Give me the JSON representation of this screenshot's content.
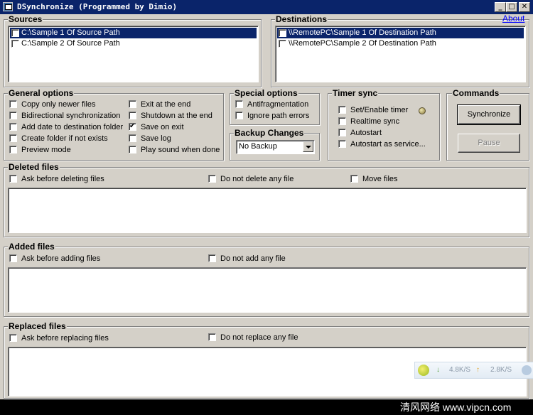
{
  "window": {
    "title": "DSynchronize (Programmed by Dimio)",
    "min": "_",
    "max": "□",
    "close": "✕"
  },
  "sources": {
    "title": "Sources",
    "items": [
      {
        "path": "C:\\Sample 1 Of Source Path",
        "selected": true
      },
      {
        "path": "C:\\Sample 2 Of Source Path",
        "selected": false
      }
    ]
  },
  "destinations": {
    "title": "Destinations",
    "about": "About",
    "items": [
      {
        "path": "\\\\RemotePC\\Sample 1 Of Destination Path",
        "selected": true
      },
      {
        "path": "\\\\RemotePC\\Sample 2 Of Destination Path",
        "selected": false
      }
    ]
  },
  "general_options": {
    "title": "General options",
    "col1": [
      {
        "label": "Copy only newer files",
        "checked": false
      },
      {
        "label": "Bidirectional synchronization",
        "checked": false
      },
      {
        "label": "Add date to destination folder",
        "checked": false
      },
      {
        "label": "Create folder if not exists",
        "checked": false
      },
      {
        "label": "Preview mode",
        "checked": false
      }
    ],
    "col2": [
      {
        "label": "Exit at the end",
        "checked": false
      },
      {
        "label": "Shutdown at the end",
        "checked": false
      },
      {
        "label": "Save on exit",
        "checked": true
      },
      {
        "label": "Save log",
        "checked": false
      },
      {
        "label": "Play sound when done",
        "checked": false
      }
    ]
  },
  "special_options": {
    "title": "Special options",
    "items": [
      {
        "label": "Antifragmentation",
        "checked": false
      },
      {
        "label": "Ignore path errors",
        "checked": false
      }
    ]
  },
  "backup_changes": {
    "title": "Backup Changes",
    "selected": "No Backup"
  },
  "timer_sync": {
    "title": "Timer sync",
    "items": [
      {
        "label": "Set/Enable timer",
        "checked": false
      },
      {
        "label": "Realtime sync",
        "checked": false
      },
      {
        "label": "Autostart",
        "checked": false
      },
      {
        "label": "Autostart as service...",
        "checked": false
      }
    ]
  },
  "commands": {
    "title": "Commands",
    "synchronize": "Synchronize",
    "pause": "Pause"
  },
  "deleted_files": {
    "title": "Deleted files",
    "options": [
      {
        "label": "Ask before deleting files",
        "checked": false
      },
      {
        "label": "Do not delete any file",
        "checked": false
      },
      {
        "label": "Move files",
        "checked": false
      }
    ]
  },
  "added_files": {
    "title": "Added files",
    "options": [
      {
        "label": "Ask before adding files",
        "checked": false
      },
      {
        "label": "Do not add any file",
        "checked": false
      }
    ]
  },
  "replaced_files": {
    "title": "Replaced files",
    "options": [
      {
        "label": "Ask before replacing files",
        "checked": false
      },
      {
        "label": "Do not replace any file",
        "checked": false
      }
    ]
  },
  "net_monitor": {
    "down_arrow": "↓",
    "down_speed": "4.8K/S",
    "up_arrow": "↑",
    "up_speed": "2.8K/S"
  },
  "watermark": "清风网络 www.vipcn.com"
}
